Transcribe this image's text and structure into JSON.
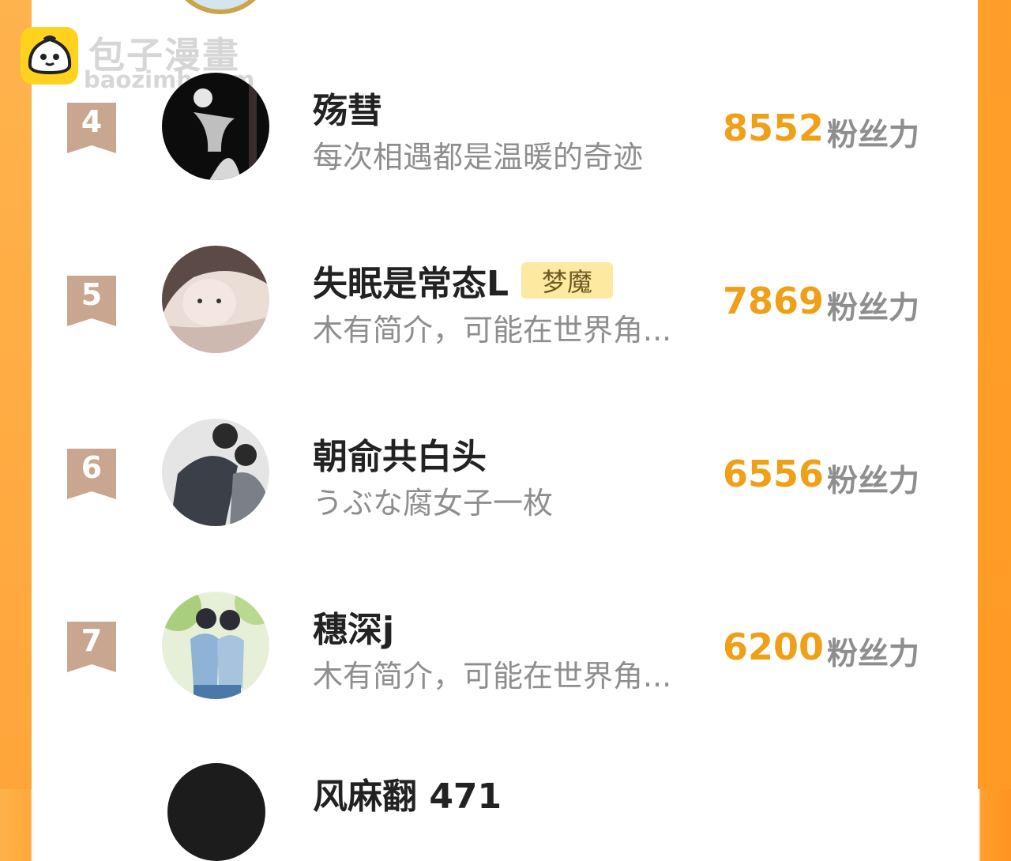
{
  "watermark": {
    "title": "包子漫畫",
    "url": "baozimh.com"
  },
  "score_unit": "粉丝力",
  "rows": [
    {
      "rank": "4",
      "name": "殇彗",
      "badge": "",
      "bio": "每次相遇都是温暖的奇迹",
      "score": "8552"
    },
    {
      "rank": "5",
      "name": "失眠是常态L",
      "badge": "梦魔",
      "bio": "木有简介，可能在世界角...",
      "score": "7869"
    },
    {
      "rank": "6",
      "name": "朝俞共白头",
      "badge": "",
      "bio": "うぶな腐女子一枚",
      "score": "6556"
    },
    {
      "rank": "7",
      "name": "穗深j",
      "badge": "",
      "bio": "木有简介，可能在世界角...",
      "score": "6200"
    }
  ],
  "next_row_partial": {
    "name": "风麻翻 471"
  },
  "colors": {
    "accent": "#f0a018",
    "rank_ribbon": "#c8a68f",
    "frame_orange": "#ffa83a",
    "badge_bg": "#fde9a0"
  }
}
